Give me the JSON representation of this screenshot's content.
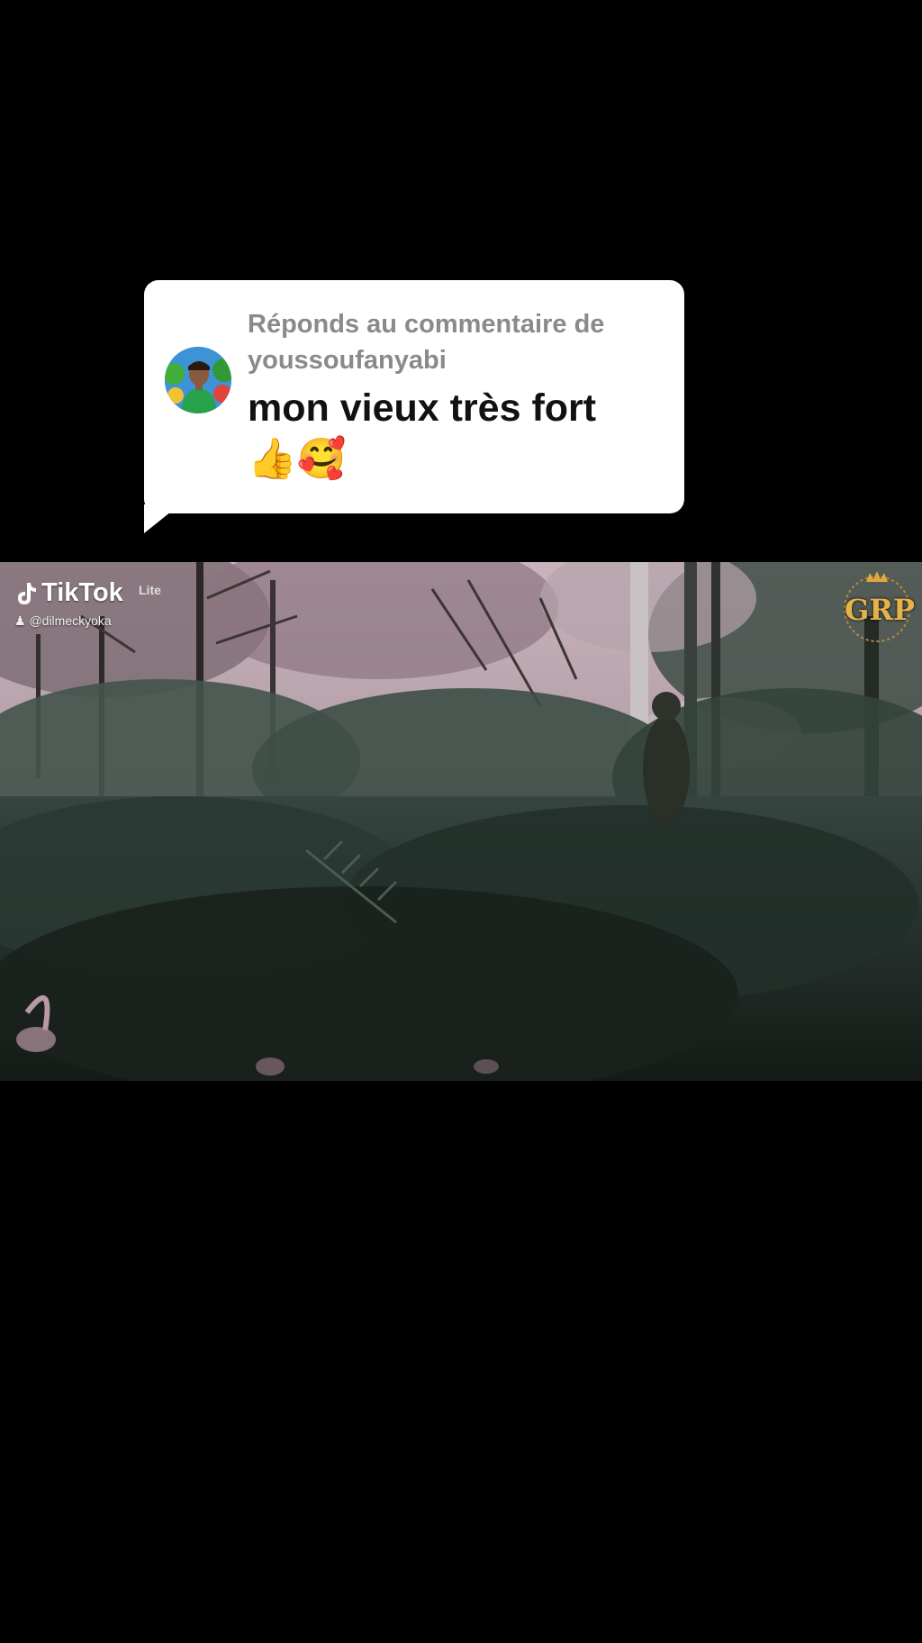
{
  "reply": {
    "header": "Réponds au commentaire de youssoufanyabi",
    "comment": "mon vieux très fort",
    "emojis": "👍🥰",
    "avatar_icon": "user-avatar"
  },
  "video": {
    "watermark_brand": "TikTok",
    "watermark_variant": "Lite",
    "watermark_handle": "@dilmeckyoka",
    "corner_badge": "GRP"
  },
  "colors": {
    "background": "#000000",
    "bubble": "#ffffff",
    "header_text": "#8a8a8a",
    "comment_text": "#111111",
    "badge_gold": "#e8b24a"
  }
}
